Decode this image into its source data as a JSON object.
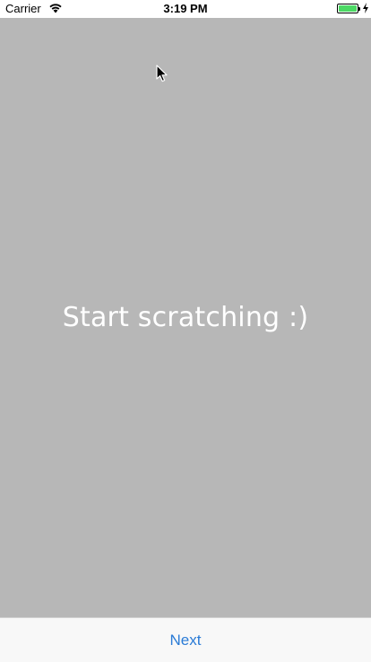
{
  "status_bar": {
    "carrier": "Carrier",
    "time": "3:19 PM",
    "battery_level": 1.0,
    "charging": true,
    "icons": [
      "wifi-icon",
      "battery-icon",
      "charging-icon"
    ]
  },
  "scratch_area": {
    "message": "Start scratching :)",
    "background_color": "#b7b7b7"
  },
  "bottom_bar": {
    "next_label": "Next",
    "accent_color": "#2a7bd6"
  }
}
